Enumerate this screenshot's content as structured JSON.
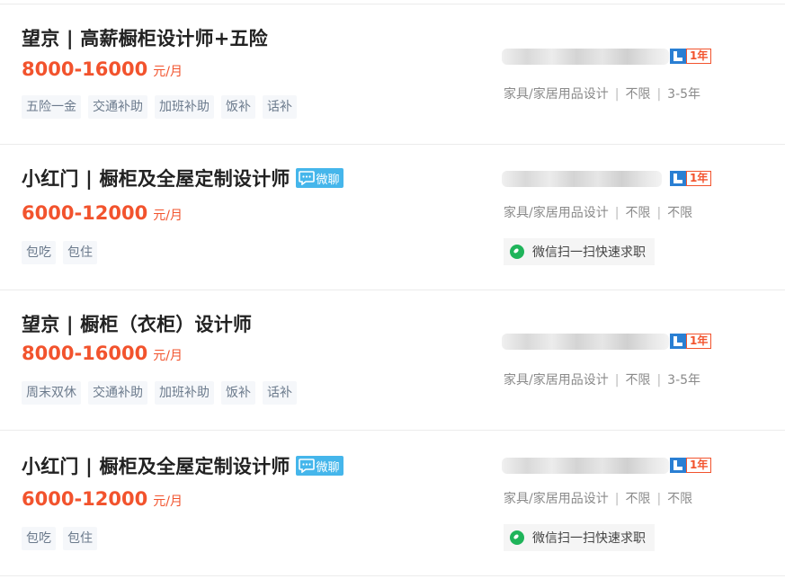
{
  "jobs": [
    {
      "title": "望京 | 高薪橱柜设计师+五险",
      "salary_amount": "8000-16000",
      "salary_unit": "元/月",
      "tags": [
        "五险一金",
        "交通补助",
        "加班补助",
        "饭补",
        "话补"
      ],
      "company_blurred": true,
      "member_years": "1年",
      "industry": "家具/家居用品设计",
      "education": "不限",
      "experience": "3-5年",
      "wechat_chat": false,
      "scan_apply": ""
    },
    {
      "title": "小红门 | 橱柜及全屋定制设计师",
      "salary_amount": "6000-12000",
      "salary_unit": "元/月",
      "tags": [
        "包吃",
        "包住"
      ],
      "company_blurred": true,
      "member_years": "1年",
      "industry": "家具/家居用品设计",
      "education": "不限",
      "experience": "不限",
      "wechat_chat": true,
      "wechat_label": "微聊",
      "scan_apply": "微信扫一扫快速求职"
    },
    {
      "title": "望京 | 橱柜（衣柜）设计师",
      "salary_amount": "8000-16000",
      "salary_unit": "元/月",
      "tags": [
        "周末双休",
        "交通补助",
        "加班补助",
        "饭补",
        "话补"
      ],
      "company_blurred": true,
      "member_years": "1年",
      "industry": "家具/家居用品设计",
      "education": "不限",
      "experience": "3-5年",
      "wechat_chat": false,
      "scan_apply": ""
    },
    {
      "title": "小红门 | 橱柜及全屋定制设计师",
      "salary_amount": "6000-12000",
      "salary_unit": "元/月",
      "tags": [
        "包吃",
        "包住"
      ],
      "company_blurred": true,
      "member_years": "1年",
      "industry": "家具/家居用品设计",
      "education": "不限",
      "experience": "不限",
      "wechat_chat": true,
      "wechat_label": "微聊",
      "scan_apply": "微信扫一扫快速求职"
    }
  ],
  "separator": "|",
  "colors": {
    "salary": "#f2532d",
    "wechat_badge": "#45b6eb",
    "scan_icon": "#1fb45a",
    "vip_icon": "#2a7fd3"
  }
}
